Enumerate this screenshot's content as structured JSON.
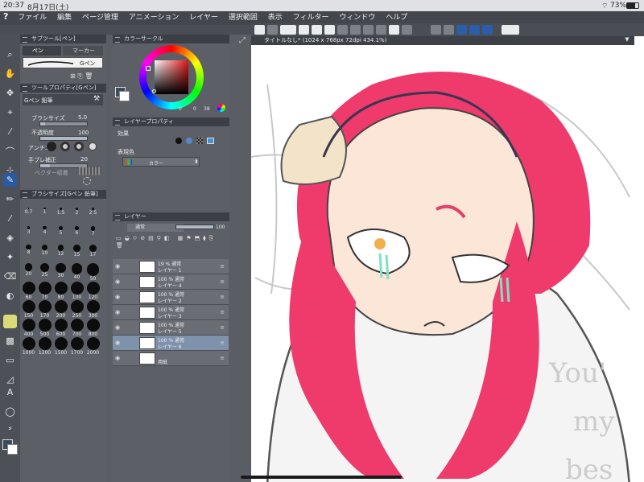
{
  "status": {
    "time": "20:37",
    "date": "8月17日(土)",
    "battery": "73%"
  },
  "menu": [
    "ファイル",
    "編集",
    "ページ管理",
    "アニメーション",
    "レイヤー",
    "選択範囲",
    "表示",
    "フィルター",
    "ウィンドウ",
    "ヘルプ"
  ],
  "subtool": {
    "title": "サブツール[ペン]",
    "tab_pen": "ペン",
    "tab_marker": "マーカー",
    "item": "Gペン"
  },
  "toolprop": {
    "title": "ツールプロパティ[Gペン]",
    "name": "Gペン 鉛筆",
    "brush_size_label": "ブラシサイズ",
    "brush_size_value": "5.0",
    "opacity_label": "不透明度",
    "opacity_value": "100",
    "antialias_label": "アンチエ",
    "stabilize_label": "手ブレ補正",
    "stabilize_value": "20",
    "vector_label": "ベクター吸着"
  },
  "brushsize": {
    "title": "ブラシサイズ[Gペン 鉛筆]",
    "sizes": [
      "0.7",
      "1",
      "1.5",
      "2",
      "2.5",
      "3",
      "4",
      "5",
      "6",
      "7",
      "8",
      "10",
      "12",
      "15",
      "17",
      "20",
      "25",
      "30",
      "40",
      "50",
      "60",
      "70",
      "80",
      "100",
      "120",
      "150",
      "170",
      "200",
      "250",
      "300",
      "400",
      "500",
      "600",
      "700",
      "800",
      "1000",
      "1200",
      "1500",
      "1700",
      "2000"
    ]
  },
  "color_circle": {
    "title": "カラーサークル",
    "v1": "0",
    "v2": "0",
    "v3": "38"
  },
  "layer_property": {
    "title": "レイヤープロパティ",
    "effect_label": "効果",
    "expression_label": "表現色",
    "expression_value": "カラー"
  },
  "layers": {
    "title": "レイヤー",
    "blend_mode": "通常",
    "opacity": "100",
    "rows": [
      {
        "l1": "19 % 通常",
        "l2": "レイヤー 1"
      },
      {
        "l1": "100 % 通常",
        "l2": "レイヤー 4"
      },
      {
        "l1": "100 % 通常",
        "l2": "レイヤー 2"
      },
      {
        "l1": "100 % 通常",
        "l2": "レイヤー 3"
      },
      {
        "l1": "100 % 通常",
        "l2": "レイヤー 5"
      },
      {
        "l1": "100 % 通常",
        "l2": "レイヤー 6"
      },
      {
        "l1": "",
        "l2": "用紙"
      }
    ]
  },
  "document": {
    "tab_title": "タイトルなし* (1024 x 768px 72dpi 434.1%)",
    "canvas_text": "You'\nmy\nbes"
  }
}
